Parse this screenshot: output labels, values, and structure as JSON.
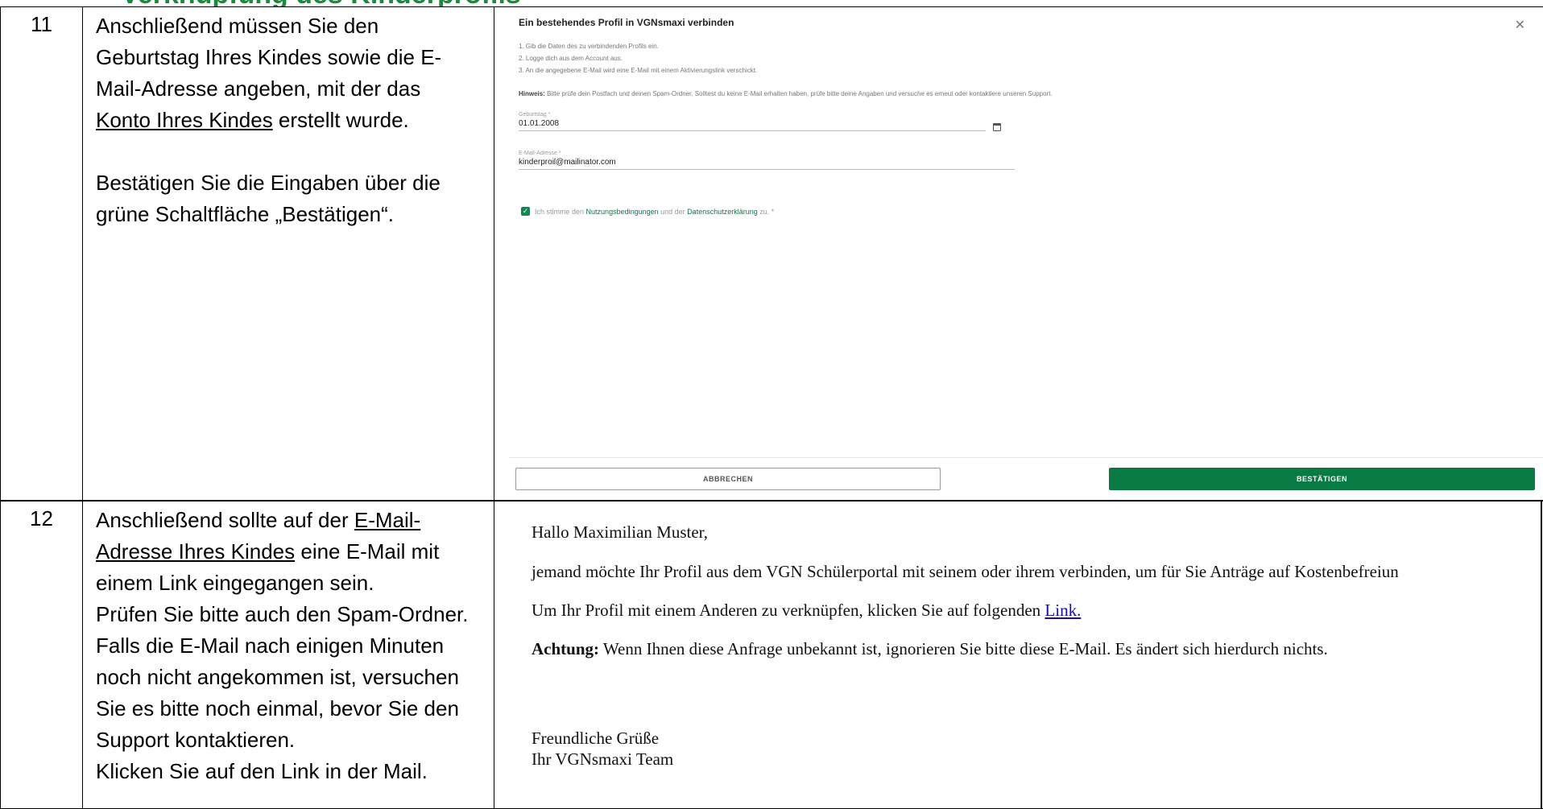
{
  "heading_fragment": "Verknüpfung des Kinderprofils",
  "rows": [
    {
      "number": "11",
      "paragraphs": [
        {
          "parts": [
            "Anschließend müssen Sie den Geburtstag Ihres Kindes sowie die E-Mail-Adresse angeben, mit der das ",
            "Konto Ihres Kindes",
            " erstellt wurde."
          ]
        },
        {
          "text": "Bestätigen Sie die Eingaben über die grüne Schaltfläche „Bestätigen“."
        }
      ]
    },
    {
      "number": "12",
      "paragraphs": [
        {
          "parts": [
            "Anschließend sollte auf der ",
            "E-Mail-Adresse Ihres Kindes",
            " eine E-Mail mit einem Link eingegangen sein."
          ]
        },
        {
          "text": "Prüfen Sie bitte auch den Spam-Ordner."
        },
        {
          "text": "Falls die E-Mail nach einigen Minuten noch nicht angekommen ist, versuchen Sie es bitte noch einmal, bevor Sie den Support kontaktieren."
        },
        {
          "text": "Klicken Sie auf den Link in der Mail."
        }
      ]
    }
  ],
  "dialog": {
    "title": "Ein bestehendes Profil in VGNsmaxi verbinden",
    "close_icon": "close-icon",
    "steps": [
      "1. Gib die Daten des zu verbindenden Profils ein.",
      "2. Logge dich aus dem Account aus.",
      "3. An die angegebene E-Mail wird eine E-Mail mit einem Aktivierungslink verschickt."
    ],
    "hint_label": "Hinweis:",
    "hint_text": "Bitte prüfe dein Postfach und deinen Spam-Ordner. Solltest du keine E-Mail erhalten haben, prüfe bitte deine Angaben und versuche es erneut oder kontaktiere unseren Support.",
    "birthday_label": "Geburtstag *",
    "birthday_value": "01.01.2008",
    "calendar_icon": "calendar-icon",
    "email_label": "E-Mail-Adresse *",
    "email_value": "kinderproil@mailinator.com",
    "consent_checked": true,
    "consent_pre": "Ich stimme den",
    "consent_link1": "Nutzungsbedingungen",
    "consent_mid": "und der",
    "consent_link2": "Datenschutzerklärung",
    "consent_post": "zu. *",
    "cancel_label": "ABBRECHEN",
    "confirm_label": "BESTÄTIGEN",
    "accent_color": "#0a7a45"
  },
  "email": {
    "greeting": "Hallo Maximilian Muster,",
    "body1": "jemand möchte Ihr Profil aus dem VGN Schülerportal mit seinem oder ihrem verbinden, um für Sie Anträge auf Kostenbefreiun",
    "body2_pre": "Um Ihr Profil mit einem Anderen zu verknüpfen, klicken Sie auf folgenden",
    "body2_link": "Link.",
    "warning_label": "Achtung:",
    "warning_text": "Wenn Ihnen diese Anfrage unbekannt ist, ignorieren Sie bitte diese E-Mail. Es ändert sich hierdurch nichts.",
    "closing": "Freundliche Grüße",
    "signature": "Ihr VGNsmaxi Team"
  }
}
